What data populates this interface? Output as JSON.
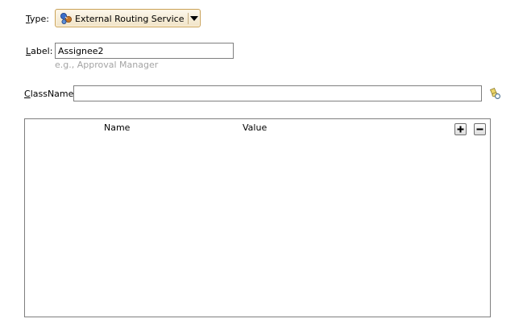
{
  "type_field": {
    "label_prefix": "",
    "label_mnemonic": "T",
    "label_rest": "ype:",
    "value": "External Routing Service",
    "icon": "external-routing-service-icon"
  },
  "label_field": {
    "label_prefix": "",
    "label_mnemonic": "L",
    "label_rest": "abel:",
    "value": "Assignee2",
    "hint": "e.g., Approval Manager"
  },
  "classname_field": {
    "label_prefix": "",
    "label_mnemonic": "C",
    "label_rest": "lassName:",
    "value": "",
    "browse_icon": "flashlight-search-icon"
  },
  "parameters_table": {
    "columns": [
      "Name",
      "Value"
    ],
    "rows": [],
    "add_icon": "plus-icon",
    "remove_icon": "minus-icon"
  },
  "colors": {
    "combo_border": "#c9a25a",
    "field_border": "#7f7f7f",
    "hint_text": "#a4a4a4"
  }
}
